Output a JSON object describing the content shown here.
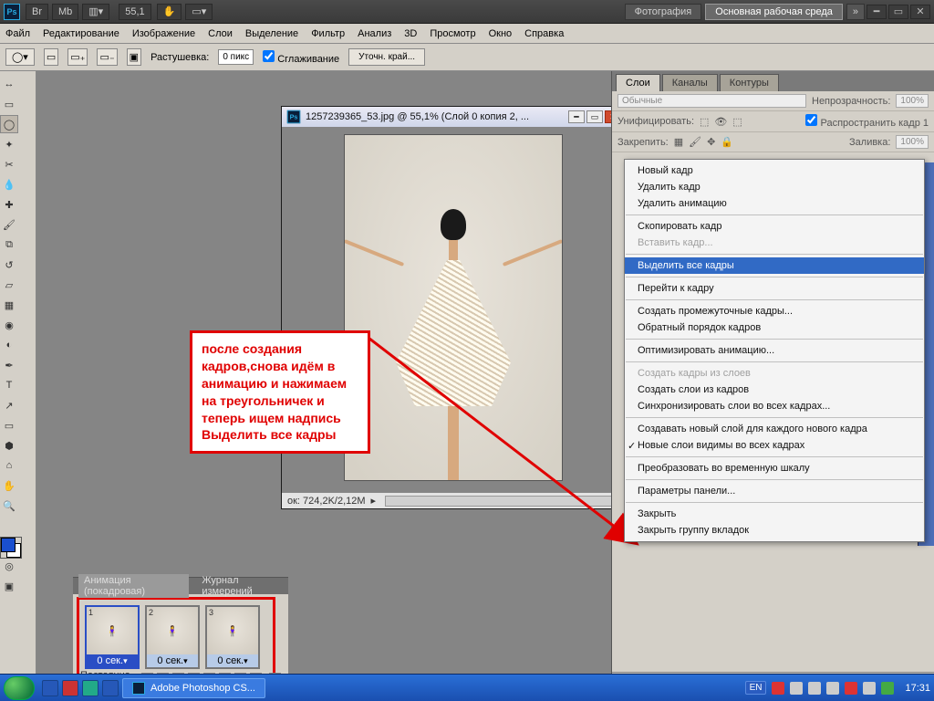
{
  "header": {
    "zoom": "55,1",
    "workspace1": "Фотография",
    "workspace2": "Основная рабочая среда",
    "chevrons": "»"
  },
  "menu": {
    "file": "Файл",
    "edit": "Редактирование",
    "image": "Изображение",
    "layer": "Слои",
    "select": "Выделение",
    "filter": "Фильтр",
    "analysis": "Анализ",
    "3d": "3D",
    "view": "Просмотр",
    "window": "Окно",
    "help": "Справка"
  },
  "options": {
    "feather_label": "Растушевка:",
    "feather_value": "0 пикс",
    "antialias": "Сглаживание",
    "refine_edge": "Уточн. край..."
  },
  "doc": {
    "title": "1257239365_53.jpg @ 55,1% (Слой 0 копия 2, ...",
    "status": "ок:  724,2K/2,12M"
  },
  "callout_text": "после создания кадров,снова идём в анимацию и нажимаем на треугольничек и теперь ищем надпись Выделить все кадры",
  "panels": {
    "tab_layers": "Слои",
    "tab_channels": "Каналы",
    "tab_paths": "Контуры",
    "blend_mode": "Обычные",
    "opacity_label": "Непрозрачность:",
    "opacity_value": "100%",
    "unify_label": "Унифицировать:",
    "propagate": "Распространить кадр 1",
    "lock_label": "Закрепить:",
    "fill_label": "Заливка:",
    "fill_value": "100%"
  },
  "frames": [
    {
      "num": "1",
      "duration": "0 сек."
    },
    {
      "num": "2",
      "duration": "0 сек."
    },
    {
      "num": "3",
      "duration": "0 сек."
    }
  ],
  "anim": {
    "tab1": "Анимация (покадровая)",
    "tab2": "Журнал измерений",
    "loop": "Постоянно"
  },
  "context_menu": {
    "new_frame": "Новый кадр",
    "delete_frame": "Удалить кадр",
    "delete_anim": "Удалить анимацию",
    "copy_frame": "Скопировать кадр",
    "paste_frame": "Вставить кадр...",
    "select_all": "Выделить все кадры",
    "goto": "Перейти к кадру",
    "tween": "Создать промежуточные кадры...",
    "reverse": "Обратный порядок кадров",
    "optimize": "Оптимизировать анимацию...",
    "from_layers": "Создать кадры из слоев",
    "layers_from": "Создать слои из кадров",
    "sync": "Синхронизировать слои во всех кадрах...",
    "new_layer_each": "Создавать новый слой для каждого нового кадра",
    "new_visible": "Новые слои видимы во всех кадрах",
    "to_timeline": "Преобразовать во временную шкалу",
    "panel_opts": "Параметры панели...",
    "close": "Закрыть",
    "close_group": "Закрыть группу вкладок"
  },
  "taskbar": {
    "app": "Adobe Photoshop CS...",
    "lang": "EN",
    "time": "17:31"
  }
}
